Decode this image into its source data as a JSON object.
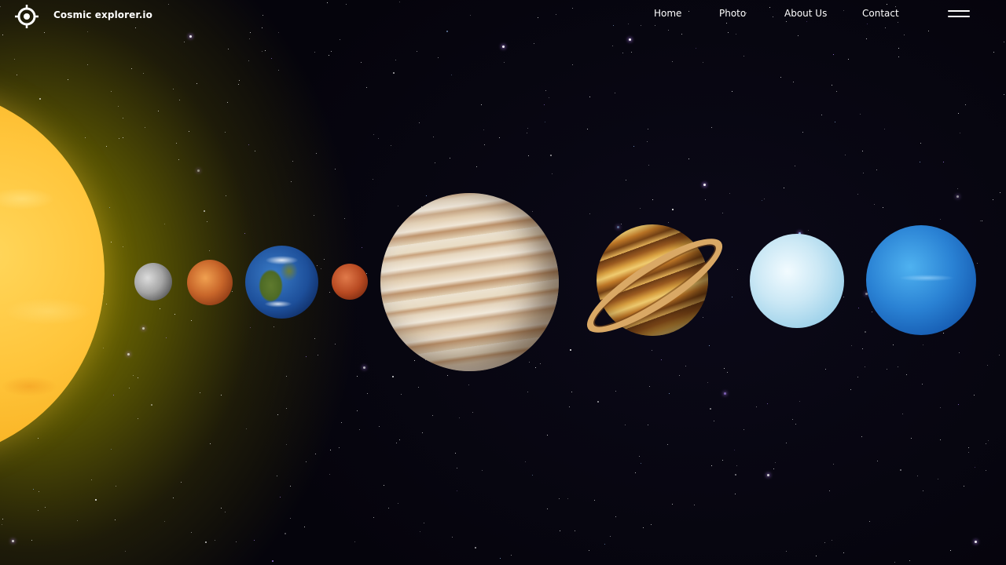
{
  "brand": {
    "name": "Cosmic explorer.io",
    "logo_icon": "compass-crosshair-icon"
  },
  "nav": {
    "items": [
      {
        "label": "Home"
      },
      {
        "label": "Photo"
      },
      {
        "label": "About Us"
      },
      {
        "label": "Contact"
      }
    ],
    "menu_icon": "hamburger-menu-icon"
  },
  "hero": {
    "bodies": [
      "sun",
      "mercury",
      "venus",
      "earth",
      "mars",
      "jupiter",
      "saturn",
      "uranus",
      "neptune"
    ]
  },
  "colors": {
    "text": "#ffffff",
    "sky": "#05040c",
    "sun_glow": "#968c00"
  }
}
